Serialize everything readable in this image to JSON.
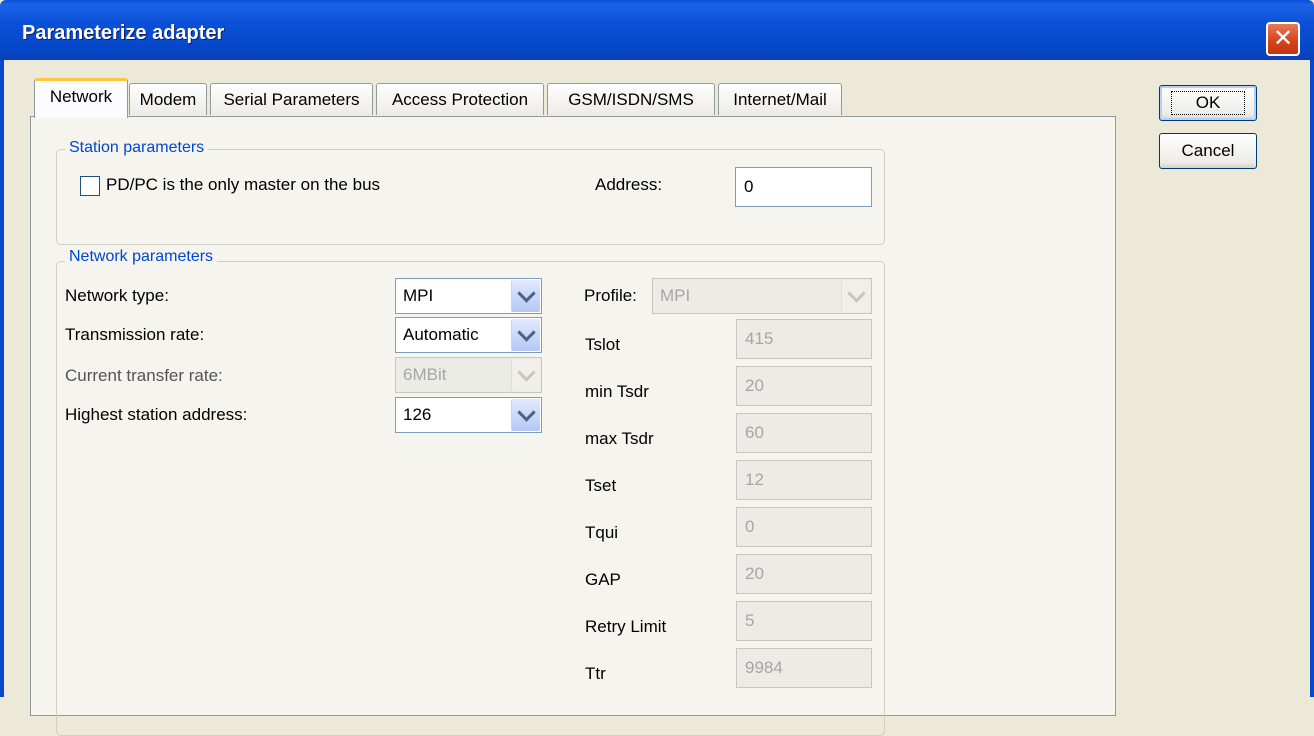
{
  "window": {
    "title": "Parameterize adapter"
  },
  "tabs": [
    "Network",
    "Modem",
    "Serial Parameters",
    "Access Protection",
    "GSM/ISDN/SMS",
    "Internet/Mail"
  ],
  "buttons": {
    "ok": "OK",
    "cancel": "Cancel"
  },
  "station": {
    "title": "Station parameters",
    "only_master_label": "PD/PC is the only master on the bus",
    "only_master_checked": false,
    "address_label": "Address:",
    "address_value": "0"
  },
  "network": {
    "title": "Network parameters",
    "network_type_label": "Network type:",
    "network_type_value": "MPI",
    "transmission_rate_label": "Transmission rate:",
    "transmission_rate_value": "Automatic",
    "current_rate_label": "Current transfer rate:",
    "current_rate_value": "6MBit",
    "highest_address_label": "Highest station address:",
    "highest_address_value": "126",
    "profile_label": "Profile:",
    "profile_value": "MPI",
    "params": [
      {
        "label": "Tslot",
        "value": "415"
      },
      {
        "label": "min Tsdr",
        "value": "20"
      },
      {
        "label": "max Tsdr",
        "value": "60"
      },
      {
        "label": "Tset",
        "value": "12"
      },
      {
        "label": "Tqui",
        "value": "0"
      },
      {
        "label": "GAP",
        "value": "20"
      },
      {
        "label": "Retry Limit",
        "value": "5"
      },
      {
        "label": "Ttr",
        "value": "9984"
      }
    ]
  },
  "colors": {
    "title_bar": "#0a50d6",
    "group_title": "#0046d5",
    "active_tab_highlight": "#ffc83c",
    "close_button": "#d8431c"
  },
  "icons": {
    "close": "close-x-icon",
    "dropdown": "chevron-down-icon"
  }
}
